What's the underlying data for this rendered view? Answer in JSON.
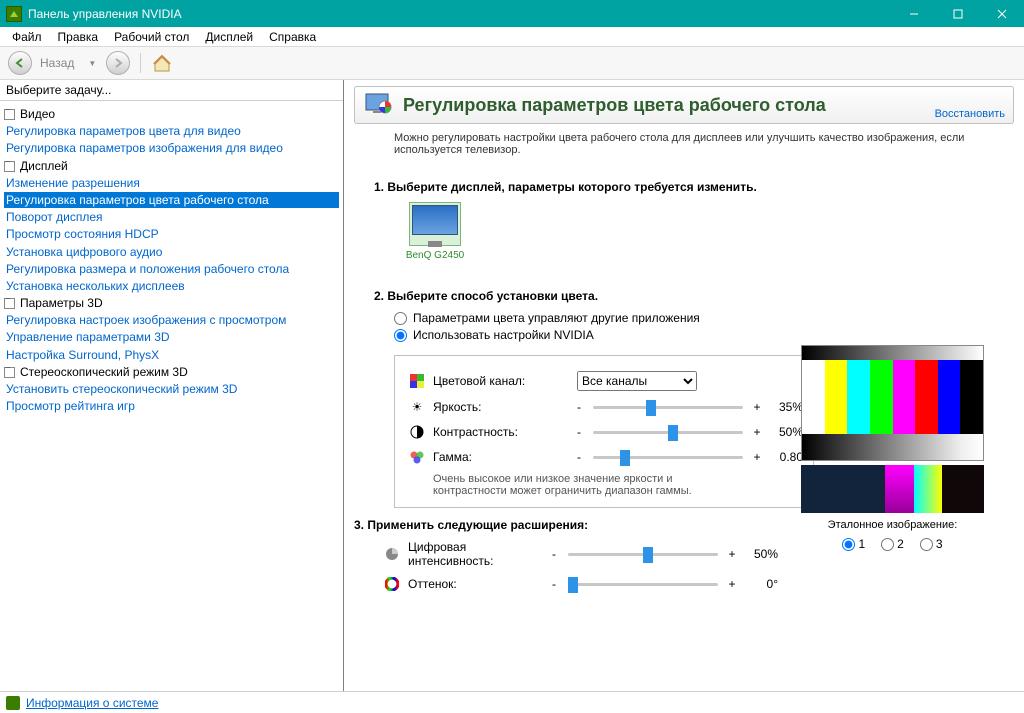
{
  "window": {
    "title": "Панель управления NVIDIA"
  },
  "menu": {
    "file": "Файл",
    "edit": "Правка",
    "desktop": "Рабочий стол",
    "display": "Дисплей",
    "help": "Справка"
  },
  "toolbar": {
    "back": "Назад"
  },
  "sidebar": {
    "header": "Выберите задачу...",
    "groups": [
      {
        "label": "Видео",
        "items": [
          {
            "label": "Регулировка параметров цвета для видео"
          },
          {
            "label": "Регулировка параметров изображения для видео"
          }
        ]
      },
      {
        "label": "Дисплей",
        "items": [
          {
            "label": "Изменение разрешения"
          },
          {
            "label": "Регулировка параметров цвета рабочего стола",
            "selected": true
          },
          {
            "label": "Поворот дисплея"
          },
          {
            "label": "Просмотр состояния HDCP"
          },
          {
            "label": "Установка цифрового аудио"
          },
          {
            "label": "Регулировка размера и положения рабочего стола"
          },
          {
            "label": "Установка нескольких дисплеев"
          }
        ]
      },
      {
        "label": "Параметры 3D",
        "items": [
          {
            "label": "Регулировка настроек изображения с просмотром"
          },
          {
            "label": "Управление параметрами 3D"
          },
          {
            "label": "Настройка Surround, PhysX"
          }
        ]
      },
      {
        "label": "Стереоскопический режим 3D",
        "items": [
          {
            "label": "Установить стереоскопический режим 3D"
          },
          {
            "label": "Просмотр рейтинга игр"
          }
        ]
      }
    ]
  },
  "page": {
    "title": "Регулировка параметров цвета рабочего стола",
    "restore": "Восстановить",
    "desc": "Можно регулировать настройки цвета рабочего стола для дисплеев или улучшить качество изображения, если используется телевизор.",
    "s1": "1. Выберите дисплей, параметры которого требуется изменить.",
    "display_name": "BenQ G2450",
    "s2": "2. Выберите способ установки цвета.",
    "radio_other": "Параметрами цвета управляют другие приложения",
    "radio_nvidia": "Использовать настройки NVIDIA",
    "channel_label": "Цветовой канал:",
    "channel_value": "Все каналы",
    "brightness_label": "Яркость:",
    "brightness_value": "35%",
    "contrast_label": "Контрастность:",
    "contrast_value": "50%",
    "gamma_label": "Гамма:",
    "gamma_value": "0.80",
    "hint": "Очень высокое или низкое значение яркости и контрастности может ограничить диапазон гаммы.",
    "s3": "3. Применить следующие расширения:",
    "vibrance_label": "Цифровая интенсивность:",
    "vibrance_value": "50%",
    "hue_label": "Оттенок:",
    "hue_value": "0°",
    "ref_label": "Эталонное изображение:",
    "ref_1": "1",
    "ref_2": "2",
    "ref_3": "3"
  },
  "status": {
    "sysinfo": "Информация о системе"
  }
}
